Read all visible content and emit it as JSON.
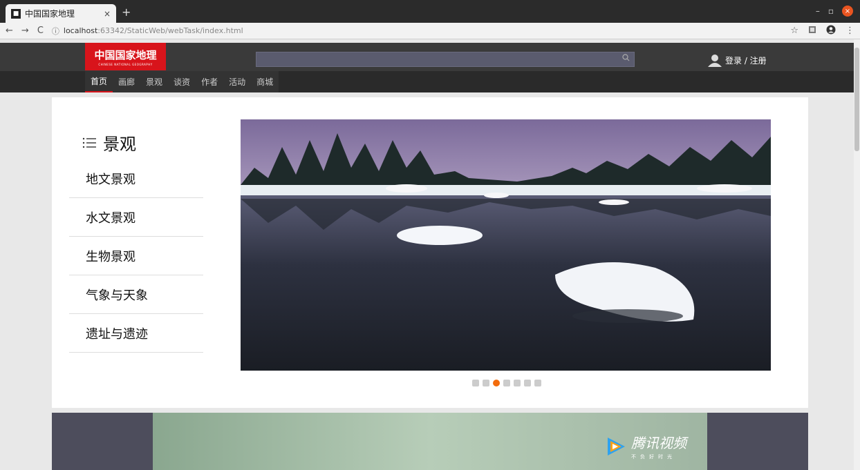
{
  "browser": {
    "tab_title": "中国国家地理",
    "tab_close": "×",
    "new_tab": "+",
    "url_host": "localhost",
    "url_path": ":63342/StaticWeb/webTask/index.html",
    "back": "←",
    "forward": "→",
    "reload": "C",
    "info": "ⓘ",
    "star": "☆",
    "menu": "⋮",
    "minimize": "–",
    "restore": "▫",
    "close": "×"
  },
  "header": {
    "logo_cn": "中国国家地理",
    "logo_en": "CHINESE NATIONAL GEOGRAPHY",
    "search_placeholder": "",
    "auth_label": "登录 / 注册"
  },
  "nav": {
    "items": [
      "首页",
      "画廊",
      "景观",
      "谈资",
      "作者",
      "活动",
      "商城"
    ],
    "active_index": 0
  },
  "sidebar": {
    "title": "景观",
    "items": [
      "地文景观",
      "水文景观",
      "生物景观",
      "气象与天象",
      "遗址与遗迹"
    ]
  },
  "carousel": {
    "slide_count": 7,
    "active_index": 2
  },
  "video": {
    "brand": "腾讯视频",
    "slogan": "不负好时光"
  },
  "colors": {
    "brand_red": "#d8141b",
    "carousel_active": "#f36c0d",
    "header_bg": "#3a3a3a"
  }
}
